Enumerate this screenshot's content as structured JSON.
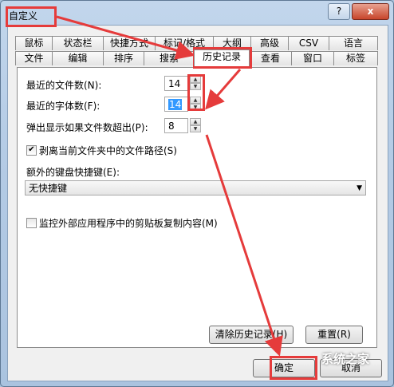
{
  "window": {
    "title": "自定义",
    "help_label": "?",
    "close_label": "x"
  },
  "tabs_row1": [
    "鼠标",
    "状态栏",
    "快捷方式",
    "标记/格式",
    "大纲",
    "高级",
    "CSV",
    "语言"
  ],
  "tabs_row2": [
    "文件",
    "编辑",
    "排序",
    "搜索",
    "历史记录",
    "查看",
    "窗口",
    "标签"
  ],
  "active_tab": "历史记录",
  "settings": {
    "recent_files_label": "最近的文件数(N):",
    "recent_files_value": "14",
    "recent_fonts_label": "最近的字体数(F):",
    "recent_fonts_value": "14",
    "popup_label": "弹出显示如果文件数超出(P):",
    "popup_value": "8",
    "strip_path_label": "剥离当前文件夹中的文件路径(S)",
    "strip_path_checked": true,
    "hotkey_label": "额外的键盘快捷键(E):",
    "hotkey_value": "无快捷键",
    "monitor_clip_label": "监控外部应用程序中的剪贴板复制内容(M)",
    "monitor_clip_checked": false
  },
  "buttons": {
    "clear_history": "清除历史记录(H)",
    "reset": "重置(R)",
    "ok": "确定",
    "cancel": "取消"
  },
  "watermark": "系统之家",
  "highlight_color": "#e53b3b"
}
